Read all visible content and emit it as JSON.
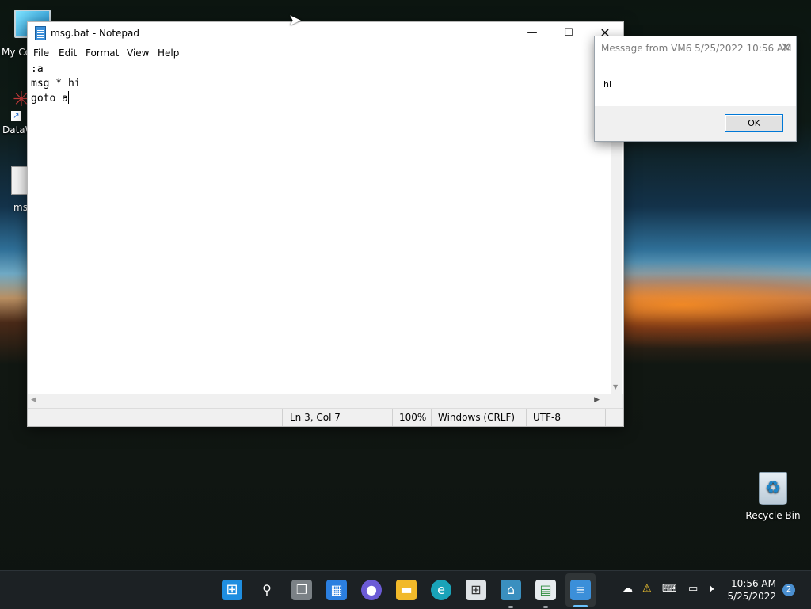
{
  "desktop": {
    "icons": [
      {
        "label": "My Co",
        "icon": "computer-icon"
      },
      {
        "label": "DataW",
        "icon": "datawrapper-icon"
      },
      {
        "label": "ms",
        "icon": "file-icon"
      }
    ],
    "recycle_bin": {
      "label": "Recycle Bin",
      "icon": "recycle-bin-icon"
    }
  },
  "notepad": {
    "title": "msg.bat - Notepad",
    "menu": [
      "File",
      "Edit",
      "Format",
      "View",
      "Help"
    ],
    "lines": [
      ":a",
      "msg * hi",
      "goto a"
    ],
    "status": {
      "position": "Ln 3, Col 7",
      "zoom": "100%",
      "line_ending": "Windows (CRLF)",
      "encoding": "UTF-8"
    }
  },
  "message_box": {
    "title": "Message from VM6 5/25/2022 10:56 AM",
    "body": "hi",
    "ok_label": "OK"
  },
  "taskbar": {
    "apps": [
      "start-icon",
      "search-icon",
      "task-view-icon",
      "widgets-icon",
      "chat-icon",
      "file-explorer-icon",
      "edge-icon",
      "store-icon",
      "network-app-icon",
      "control-panel-icon",
      "notepad-icon"
    ],
    "clock": {
      "time": "10:56 AM",
      "date": "5/25/2022"
    },
    "notification_count": "2"
  },
  "colors": {
    "accent": "#0078d7",
    "taskbar": "#1c2124"
  }
}
